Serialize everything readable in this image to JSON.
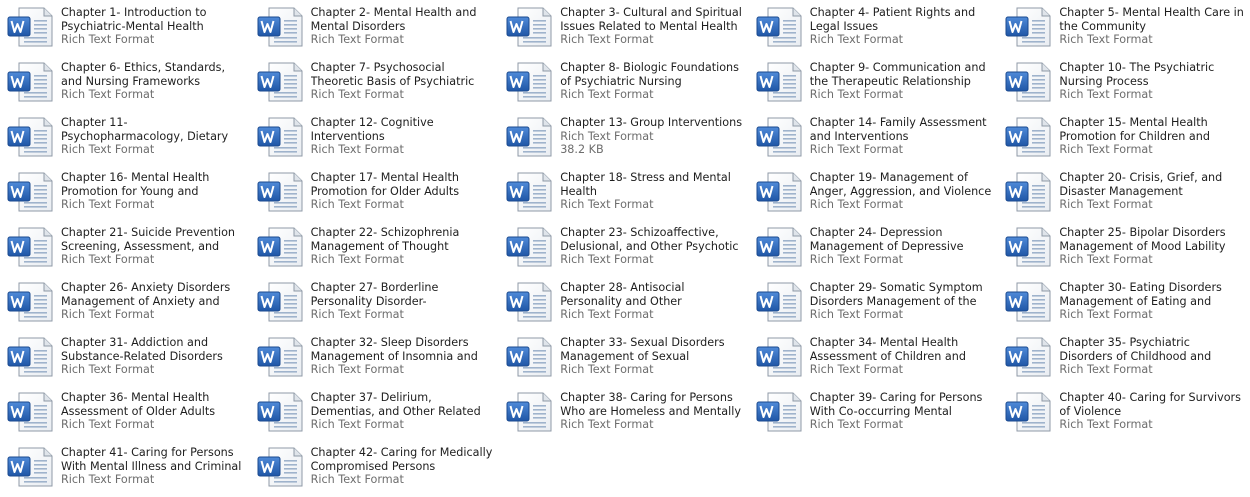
{
  "files": [
    {
      "name": "Chapter 1- Introduction to Psychiatric-Mental Health Nursin...",
      "type": "Rich Text Format"
    },
    {
      "name": "Chapter 2- Mental Health and Mental Disorders",
      "type": "Rich Text Format"
    },
    {
      "name": "Chapter 3- Cultural and Spiritual Issues Related to Mental Health C...",
      "type": "Rich Text Format"
    },
    {
      "name": "Chapter 4- Patient Rights and Legal Issues",
      "type": "Rich Text Format"
    },
    {
      "name": "Chapter 5- Mental Health Care in the Community",
      "type": "Rich Text Format"
    },
    {
      "name": "Chapter 6- Ethics, Standards, and Nursing Frameworks",
      "type": "Rich Text Format"
    },
    {
      "name": "Chapter 7- Psychosocial Theoretic Basis of Psychiatric Nursing",
      "type": "Rich Text Format"
    },
    {
      "name": "Chapter 8- Biologic Foundations of Psychiatric Nursing",
      "type": "Rich Text Format"
    },
    {
      "name": "Chapter 9- Communication and the Therapeutic Relationship",
      "type": "Rich Text Format"
    },
    {
      "name": "Chapter 10- The Psychiatric Nursing Process",
      "type": "Rich Text Format"
    },
    {
      "name": "Chapter 11- Psychopharmacology, Dietary Supplements, and Biologi...",
      "type": "Rich Text Format"
    },
    {
      "name": "Chapter 12- Cognitive Interventions",
      "type": "Rich Text Format"
    },
    {
      "name": "Chapter 13- Group Interventions",
      "type": "Rich Text Format",
      "size": "38.2 KB"
    },
    {
      "name": "Chapter 14- Family Assessment and Interventions",
      "type": "Rich Text Format"
    },
    {
      "name": "Chapter 15- Mental Health Promotion for Children and Adol...",
      "type": "Rich Text Format"
    },
    {
      "name": "Chapter 16- Mental Health Promotion for Young and Middle...",
      "type": "Rich Text Format"
    },
    {
      "name": "Chapter 17- Mental Health Promotion for Older Adults",
      "type": "Rich Text Format"
    },
    {
      "name": "Chapter 18- Stress and Mental Health",
      "type": "Rich Text Format"
    },
    {
      "name": "Chapter 19- Management of Anger, Aggression, and Violence",
      "type": "Rich Text Format"
    },
    {
      "name": "Chapter 20- Crisis, Grief, and Disaster Management",
      "type": "Rich Text Format"
    },
    {
      "name": "Chapter 21- Suicide Prevention Screening, Assessment, and Inter...",
      "type": "Rich Text Format"
    },
    {
      "name": "Chapter 22- Schizophrenia Management of Thought Disorders",
      "type": "Rich Text Format"
    },
    {
      "name": "Chapter 23- Schizoaffective, Delusional, and Other Psychotic ...",
      "type": "Rich Text Format"
    },
    {
      "name": "Chapter 24- Depression Management of Depressive Moo...",
      "type": "Rich Text Format"
    },
    {
      "name": "Chapter 25- Bipolar Disorders Management of Mood Lability",
      "type": "Rich Text Format"
    },
    {
      "name": "Chapter 26- Anxiety Disorders Management of Anxiety and Panic",
      "type": "Rich Text Format"
    },
    {
      "name": "Chapter 27- Borderline Personality Disorder- Management of Emotio...",
      "type": "Rich Text Format"
    },
    {
      "name": "Chapter 28- Antisocial Personality and Other Personality and Impuls...",
      "type": "Rich Text Format"
    },
    {
      "name": "Chapter 29- Somatic Symptom Disorders Management of the Co...",
      "type": "Rich Text Format"
    },
    {
      "name": "Chapter 30- Eating Disorders Management of Eating and Weight",
      "type": "Rich Text Format"
    },
    {
      "name": "Chapter 31- Addiction and Substance-Related Disorders",
      "type": "Rich Text Format"
    },
    {
      "name": "Chapter 32- Sleep Disorders Management of Insomnia and Sle...",
      "type": "Rich Text Format"
    },
    {
      "name": "Chapter 33- Sexual Disorders Management of Sexual Dysfuncti...",
      "type": "Rich Text Format"
    },
    {
      "name": "Chapter 34- Mental Health Assessment of Children and Adol...",
      "type": "Rich Text Format"
    },
    {
      "name": "Chapter 35- Psychiatric Disorders of Childhood and Adolescence",
      "type": "Rich Text Format"
    },
    {
      "name": "Chapter 36- Mental Health Assessment of Older Adults",
      "type": "Rich Text Format"
    },
    {
      "name": "Chapter 37- Delirium, Dementias, and Other Related Disorders",
      "type": "Rich Text Format"
    },
    {
      "name": "Chapter 38- Caring for Persons Who are Homeless and Mentally Ill",
      "type": "Rich Text Format"
    },
    {
      "name": "Chapter 39- Caring for Persons With Co-occurring Mental Disord...",
      "type": "Rich Text Format"
    },
    {
      "name": "Chapter 40- Caring for Survivors of Violence",
      "type": "Rich Text Format"
    },
    {
      "name": "Chapter 41- Caring for Persons With Mental Illness and Criminal ...",
      "type": "Rich Text Format"
    },
    {
      "name": "Chapter 42- Caring for Medically Compromised Persons",
      "type": "Rich Text Format"
    }
  ],
  "icon": "word-document-icon",
  "colors": {
    "name_text": "#1e1e1e",
    "meta_text": "#6d6d6d",
    "icon_blue": "#2f6ab5"
  }
}
